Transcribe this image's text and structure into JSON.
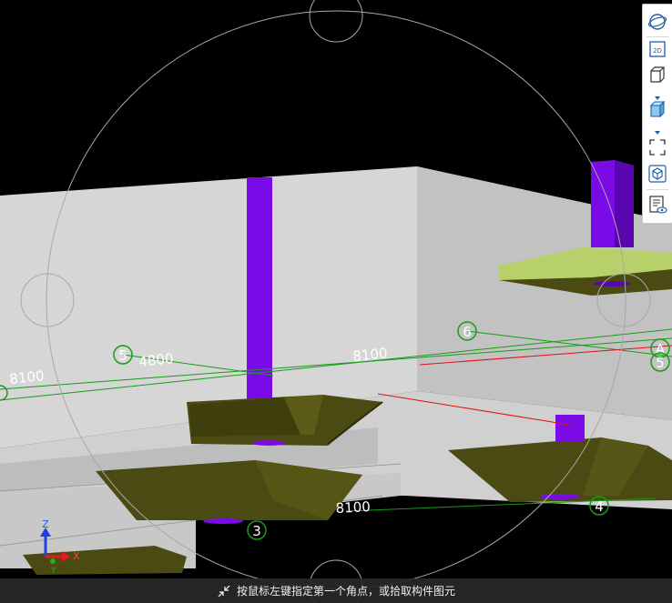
{
  "viewport": {
    "axis_labels": [
      {
        "id": "5",
        "text": "5"
      },
      {
        "id": "6",
        "text": "6"
      },
      {
        "id": "A",
        "text": "A"
      },
      {
        "id": "A2",
        "text": "5"
      },
      {
        "id": "3",
        "text": "3"
      },
      {
        "id": "4",
        "text": "4"
      }
    ],
    "dimension_labels": [
      {
        "id": "d1",
        "text": "8100"
      },
      {
        "id": "d2",
        "text": "4800"
      },
      {
        "id": "d3",
        "text": "8100"
      },
      {
        "id": "d4",
        "text": "8100"
      }
    ],
    "gizmo": {
      "z": "Z",
      "x": "X",
      "y": "Y"
    },
    "colors": {
      "background": "#000000",
      "slab": "#d3d3d3",
      "column": "#7b0be6",
      "footing": "#4a4a12",
      "cap": "#b8d06a",
      "axis_line": "#1a9a1a",
      "highlight_line": "#e01010",
      "orbit": "#a8a8a8"
    }
  },
  "toolbar": {
    "items": [
      {
        "name": "orbit-button",
        "icon": "orbit-sphere-icon"
      },
      {
        "name": "2d-view-button",
        "icon": "2d-view-icon",
        "text": "2D"
      },
      {
        "name": "view-cube-button",
        "icon": "wireframe-cube-icon"
      },
      {
        "name": "shaded-cube-button",
        "icon": "shaded-cube-icon"
      },
      {
        "name": "zoom-extents-button",
        "icon": "fit-frame-icon"
      },
      {
        "name": "component-display-button",
        "icon": "hexagon-cube-icon"
      },
      {
        "name": "view-settings-button",
        "icon": "document-eye-icon"
      }
    ]
  },
  "status": {
    "message": "按鼠标左键指定第一个角点，或拾取构件图元",
    "icon": "shrink-arrows-icon"
  }
}
